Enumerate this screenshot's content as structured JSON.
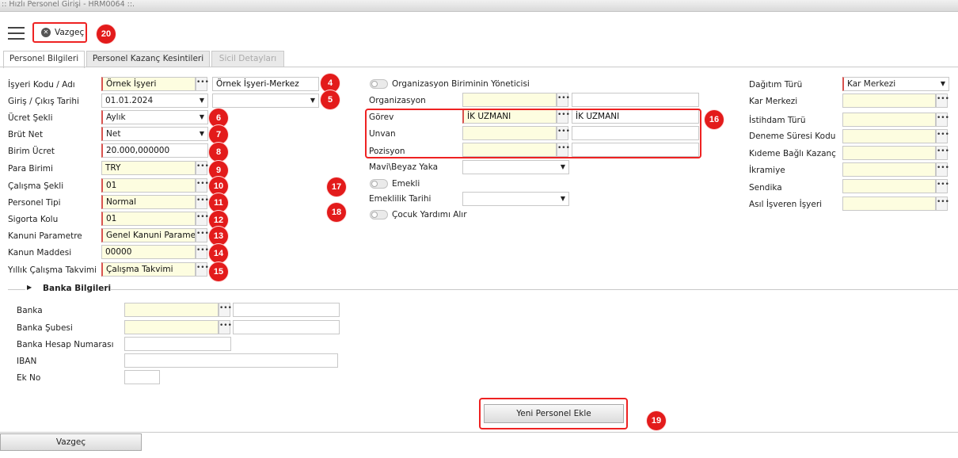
{
  "window": {
    "title": ":: Hızlı Personel Girişi - HRM0064 ::."
  },
  "toolbar": {
    "cancel_label": "Vazgeç"
  },
  "tabs": [
    "Personel Bilgileri",
    "Personel Kazanç Kesintileri",
    "Sicil Detayları"
  ],
  "left": {
    "isyeri_label": "İşyeri Kodu / Adı",
    "isyeri_value": "Örnek İşyeri",
    "isyeri_name": "Örnek İşyeri-Merkez",
    "giris_label": "Giriş / Çıkış Tarihi",
    "giris_value": "01.01.2024",
    "cikis_value": "",
    "ucret_sekli_label": "Ücret Şekli",
    "ucret_sekli_value": "Aylık",
    "brut_net_label": "Brüt Net",
    "brut_net_value": "Net",
    "birim_ucret_label": "Birim Ücret",
    "birim_ucret_value": "20.000,000000",
    "para_birimi_label": "Para Birimi",
    "para_birimi_value": "TRY",
    "calisma_sekli_label": "Çalışma Şekli",
    "calisma_sekli_value": "01",
    "personel_tipi_label": "Personel Tipi",
    "personel_tipi_value": "Normal",
    "sigorta_kolu_label": "Sigorta Kolu",
    "sigorta_kolu_value": "01",
    "kanuni_param_label": "Kanuni Parametre",
    "kanuni_param_value": "Genel Kanuni Parametre",
    "kanun_maddesi_label": "Kanun Maddesi",
    "kanun_maddesi_value": "00000",
    "yillik_label": "Yıllık Çalışma Takvimi",
    "yillik_value": "Çalışma Takvimi"
  },
  "middle": {
    "org_yonetici_label": "Organizasyon Biriminin Yöneticisi",
    "organizasyon_label": "Organizasyon",
    "gorev_label": "Görev",
    "gorev_code": "İK UZMANI",
    "gorev_name": "İK UZMANI",
    "unvan_label": "Unvan",
    "pozisyon_label": "Pozisyon",
    "mavi_beyaz_label": "Mavi\\Beyaz Yaka",
    "emekli_label": "Emekli",
    "emeklilik_tarihi_label": "Emeklilik Tarihi",
    "cocuk_label": "Çocuk Yardımı Alır"
  },
  "right": {
    "dagitim_label": "Dağıtım Türü",
    "dagitim_value": "Kar Merkezi",
    "kar_merkezi_label": "Kar Merkezi",
    "istihdam_label": "İstihdam Türü",
    "deneme_label": "Deneme Süresi Kodu",
    "kideme_label": "Kıdeme Bağlı Kazanç",
    "ikramiye_label": "İkramiye",
    "sendika_label": "Sendika",
    "asil_label": "Asıl İşveren İşyeri"
  },
  "bank": {
    "section_title": "Banka Bilgileri",
    "banka_label": "Banka",
    "sube_label": "Banka Şubesi",
    "hesap_label": "Banka Hesap Numarası",
    "iban_label": "IBAN",
    "ekno_label": "Ek No"
  },
  "actions": {
    "add_label": "Yeni Personel Ekle",
    "footer_cancel_label": "Vazgeç"
  },
  "badges": [
    "4",
    "5",
    "6",
    "7",
    "8",
    "9",
    "10",
    "11",
    "12",
    "13",
    "14",
    "15",
    "16",
    "17",
    "18",
    "19",
    "20"
  ],
  "colors": {
    "badge": "#e31b1b",
    "required_field": "#fdfde0",
    "highlight_border": "#e22"
  }
}
